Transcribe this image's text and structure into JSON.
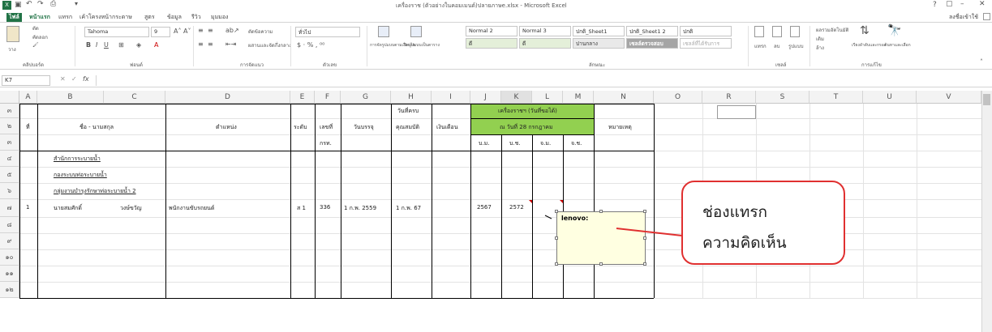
{
  "window": {
    "title": "เครื่องราช (ตัวอย่างในคอมเมนต์)ปลายภาษe.xlsx - Microsoft Excel",
    "controls": [
      "?",
      "▢",
      "–",
      "✕"
    ],
    "account": "ลงชื่อเข้าใช้"
  },
  "tabs": [
    "ไฟล์",
    "หน้าแรก",
    "แทรก",
    "เค้าโครงหน้ากระดาษ",
    "สูตร",
    "ข้อมูล",
    "รีวิว",
    "มุมมอง"
  ],
  "ribbon": {
    "font_name": "Tahoma",
    "font_size": "9",
    "clipboard_label": "คลิปบอร์ด",
    "font_label": "ฟอนต์",
    "align_label": "การจัดแนว",
    "number_label": "ตัวเลข",
    "styles_label": "ลักษณะ",
    "cells_label": "เซลล์",
    "editing_label": "การแก้ไข",
    "paste": "วาง",
    "cut": "ตัด",
    "copy": "คัดลอก",
    "wrap": "ตัดข้อความ",
    "merge": "ผสานและจัดกึ่งกลาง",
    "number_format": "ทั่วไป",
    "styles": [
      "Normal 2",
      "Normal 3",
      "ปกติ_Sheet1",
      "ปกติ_Sheet1 2",
      "ปกติ"
    ],
    "styles2": [
      "ดี",
      "ดี",
      "ปานกลาง",
      "เซลล์ตรวจสอบ",
      "เซลล์ที่ได้รับการ"
    ],
    "cf": "การจัดรูปแบบตามเงื่อนไข",
    "table": "จัดรูปแบบเป็นตาราง",
    "insert": "แทรก",
    "delete": "ลบ",
    "format": "รูปแบบ",
    "autosum": "ผลรวมอัตโนมัติ",
    "fill": "เติม",
    "clear": "ล้าง",
    "sort": "เรียงลำดับและกรอง",
    "find": "ค้นหาและเลือก"
  },
  "formula_bar": {
    "name_box": "K7",
    "fx": "fx",
    "value": ""
  },
  "columns": [
    "A",
    "B",
    "C",
    "D",
    "E",
    "F",
    "G",
    "H",
    "I",
    "J",
    "K",
    "L",
    "M",
    "N",
    "O",
    "R",
    "S",
    "T",
    "U",
    "V"
  ],
  "rows": [
    "๓",
    "๒",
    "๓",
    "๔",
    "๕",
    "๖",
    "๗",
    "๘",
    "๙",
    "๑๐",
    "๑๑",
    "๑๒"
  ],
  "sheet": {
    "h_no": "ที่",
    "h_name": "ชื่อ - นามสกุล",
    "h_position": "ตำแหน่ง",
    "h_level": "ระดับ",
    "h_number": "เลขที่",
    "h_number2": "กรท.",
    "h_start": "วันบรรจุ",
    "h_qual1": "วันที่ครบ",
    "h_qual2": "คุณสมบัติ",
    "h_salary": "เงินเดือน",
    "h_decor1": "เครื่องราชฯ (วันที่ขอได้)",
    "h_decor2": "ณ วันที่ 28 กรกฎาคม",
    "h_j": "บ.ม.",
    "h_k": "บ.ช.",
    "h_l": "จ.ม.",
    "h_m": "จ.ช.",
    "h_note": "หมายเหตุ",
    "org1": "สำนักการระบายน้ำ",
    "org2": "กองระบบท่อระบายน้ำ",
    "org3": "กลุ่มงานบำรุงรักษาท่อระบายน้ำ 2",
    "r_no": "1",
    "r_first": "นายสมศักดิ์",
    "r_last": "วงษ์ขวัญ",
    "r_position": "พนักงานขับรถยนต์",
    "r_level": "ส 1",
    "r_number": "336",
    "r_start": "1 ก.พ. 2559",
    "r_qual": "1 ก.พ. 67",
    "r_j": "2567",
    "r_k": "2572"
  },
  "comment": {
    "author": "lenovo:"
  },
  "callout": {
    "line1": "ช่องแทรก",
    "line2": "ความคิดเห็น"
  },
  "colors": {
    "excel_green": "#217346",
    "header_green": "#92d050",
    "comment_bg": "#ffffe1",
    "callout_border": "#e03030"
  }
}
